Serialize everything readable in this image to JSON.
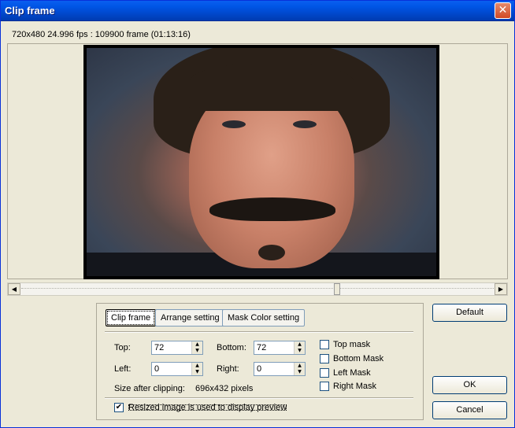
{
  "window": {
    "title": "Clip frame",
    "close_glyph": "✕"
  },
  "info": {
    "video_info": "720x480 24.996 fps : 109900 frame (01:13:16)"
  },
  "scrollbar": {
    "left_glyph": "◀",
    "right_glyph": "▶",
    "position_fraction": 0.67
  },
  "tabs": [
    {
      "label": "Clip frame"
    },
    {
      "label": "Arrange setting"
    },
    {
      "label": "Mask Color setting"
    }
  ],
  "clip": {
    "top_label": "Top:",
    "top_value": "72",
    "bottom_label": "Bottom:",
    "bottom_value": "72",
    "left_label": "Left:",
    "left_value": "0",
    "right_label": "Right:",
    "right_value": "0",
    "size_label": "Size after clipping:",
    "size_value": "696x432 pixels"
  },
  "masks": {
    "top": "Top mask",
    "bottom": "Bottom Mask",
    "left": "Left Mask",
    "right": "Right Mask"
  },
  "preview_option": {
    "label": "Resized image is used to display preview",
    "check_glyph": "✔"
  },
  "buttons": {
    "default": "Default",
    "ok": "OK",
    "cancel": "Cancel"
  },
  "spin_glyphs": {
    "up": "▲",
    "down": "▼"
  }
}
